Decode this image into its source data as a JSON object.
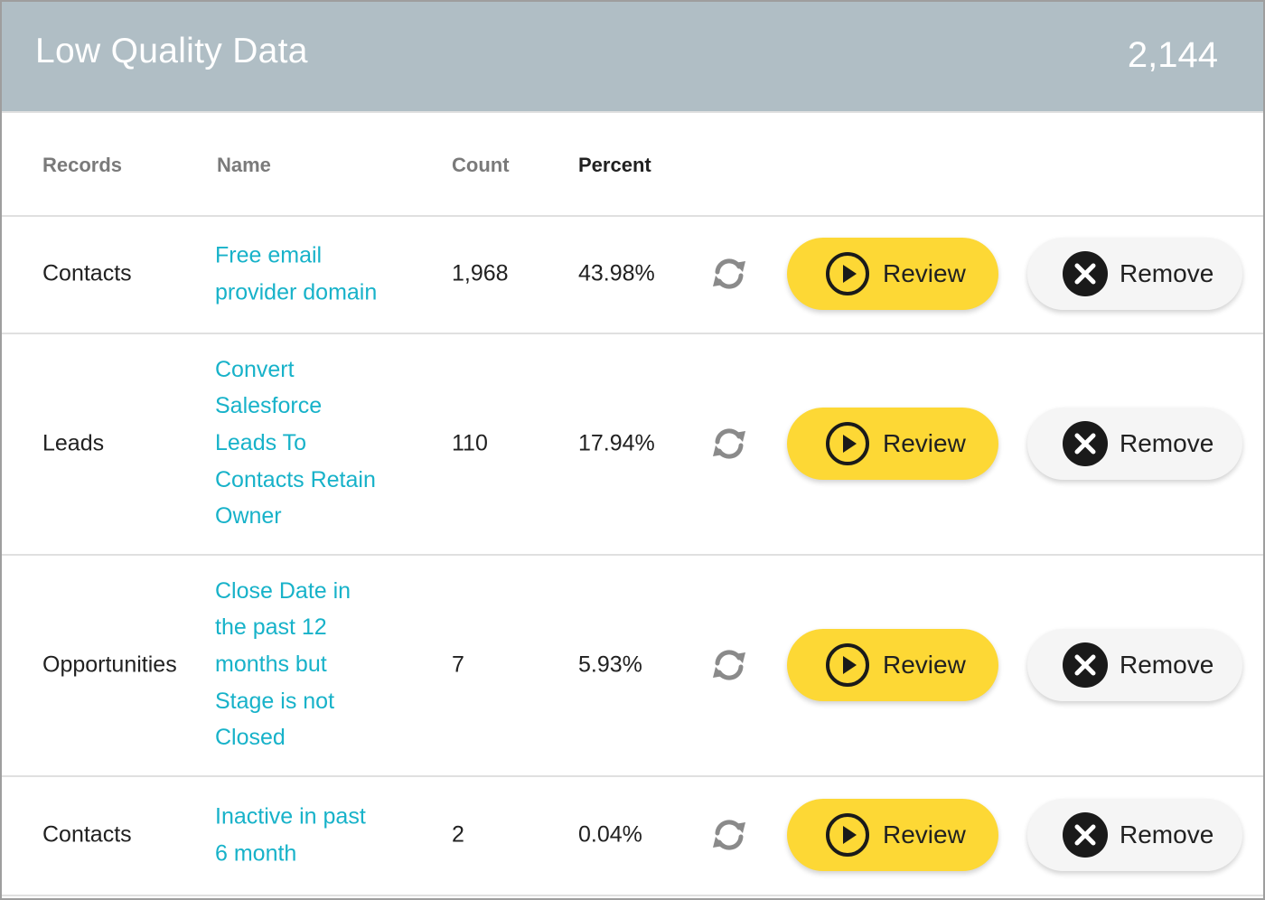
{
  "header": {
    "title": "Low Quality Data",
    "total": "2,144"
  },
  "columns": {
    "records": "Records",
    "name": "Name",
    "count": "Count",
    "percent": "Percent"
  },
  "rows": [
    {
      "record": "Contacts",
      "name_lines": [
        "Free email",
        "provider domain"
      ],
      "count": "1,968",
      "percent": "43.98%",
      "review_label": "Review",
      "remove_label": "Remove"
    },
    {
      "record": "Leads",
      "name_lines": [
        "Convert",
        "Salesforce",
        "Leads To",
        "Contacts Retain",
        "Owner"
      ],
      "count": "110",
      "percent": "17.94%",
      "review_label": "Review",
      "remove_label": "Remove"
    },
    {
      "record": "Opportunities",
      "name_lines": [
        "Close Date in",
        "the past 12",
        "months but",
        "Stage is not",
        "Closed"
      ],
      "count": "7",
      "percent": "5.93%",
      "review_label": "Review",
      "remove_label": "Remove"
    },
    {
      "record": "Contacts",
      "name_lines": [
        "Inactive in past",
        "6 month"
      ],
      "count": "2",
      "percent": "0.04%",
      "review_label": "Review",
      "remove_label": "Remove"
    }
  ],
  "icons": {
    "refresh": "refresh-icon",
    "review": "play-circle-icon",
    "remove": "close-circle-icon"
  },
  "colors": {
    "header_bg": "#b0bec5",
    "link": "#17b2c9",
    "review_button": "#fdd835",
    "remove_button": "#f5f5f5"
  }
}
